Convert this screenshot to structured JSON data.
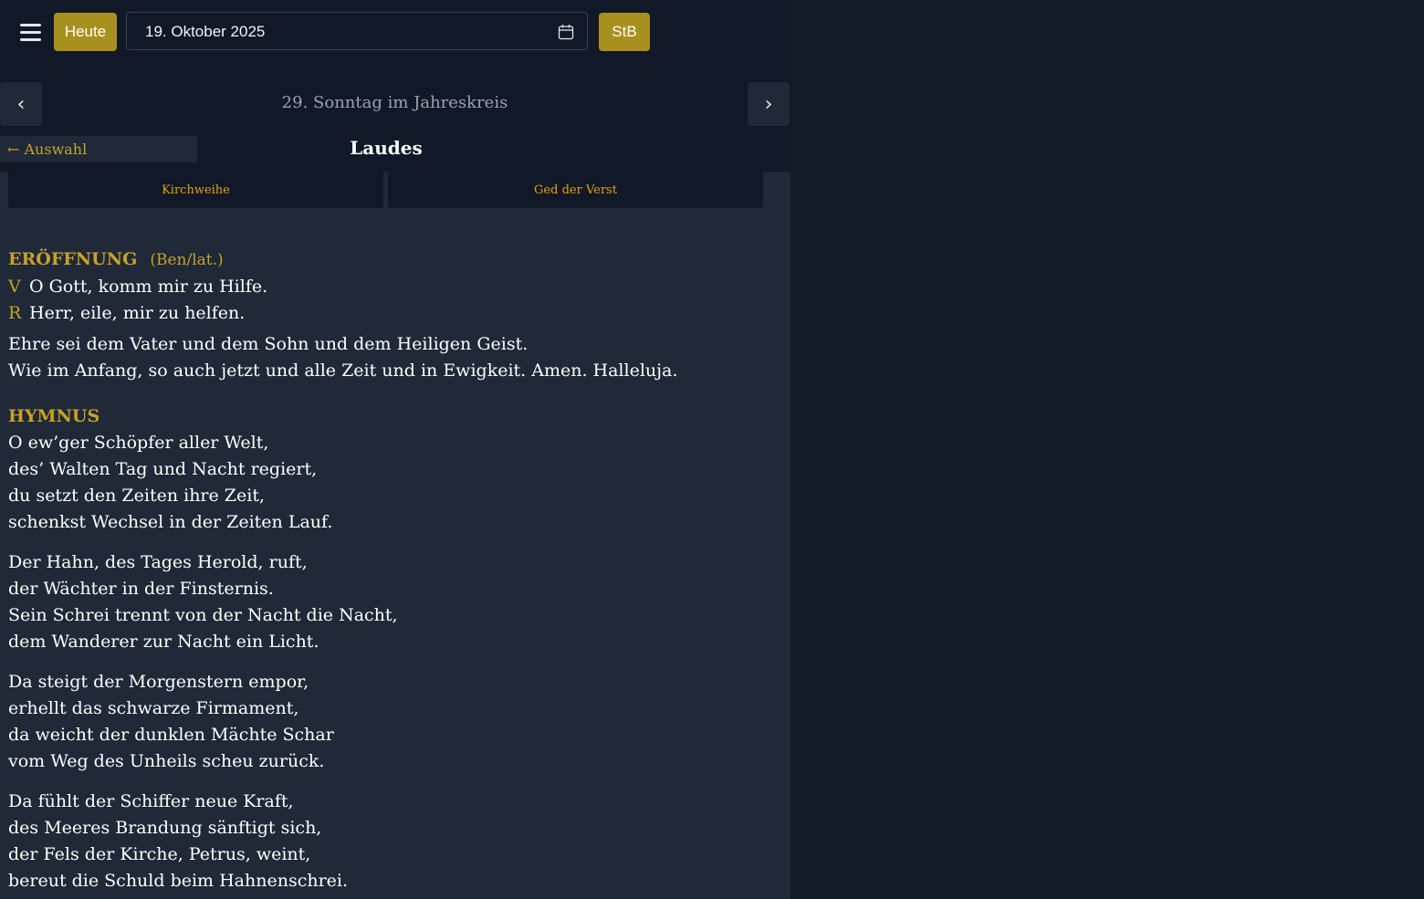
{
  "header": {
    "today_label": "Heute",
    "date_value": "19. Oktober 2025",
    "stb_label": "StB"
  },
  "nav": {
    "prev_label": "‹",
    "next_label": "›",
    "day_title": "29. Sonntag im Jahreskreis",
    "back_label": "← Auswahl",
    "hour_title": "Laudes"
  },
  "tabs": [
    "Kirchweihe",
    "Ged der Verst"
  ],
  "opening": {
    "heading": "ERÖFFNUNG",
    "heading_sub": "(Ben/lat.)",
    "v_mark": "V",
    "v_text": "O Gott, komm mir zu Hilfe.",
    "r_mark": "R",
    "r_text": "Herr, eile, mir zu helfen.",
    "doxology": [
      "Ehre sei dem Vater und dem Sohn und dem Heiligen Geist.",
      "Wie im Anfang, so auch jetzt und alle Zeit und in Ewigkeit. Amen. Halleluja."
    ]
  },
  "hymn": {
    "heading": "HYMNUS",
    "stanzas": [
      [
        "O ew’ger Schöpfer aller Welt,",
        "des’ Walten Tag und Nacht regiert,",
        "du setzt den Zeiten ihre Zeit,",
        "schenkst Wechsel in der Zeiten Lauf."
      ],
      [
        "Der Hahn, des Tages Herold, ruft,",
        "der Wächter in der Finsternis.",
        "Sein Schrei trennt von der Nacht die Nacht,",
        "dem Wanderer zur Nacht ein Licht."
      ],
      [
        "Da steigt der Morgenstern empor,",
        "erhellt das schwarze Firmament,",
        "da weicht der dunklen Mächte Schar",
        "vom Weg des Unheils scheu zurück."
      ],
      [
        "Da fühlt der Schiffer neue Kraft,",
        "des Meeres Brandung sänftigt sich,",
        "der Fels der Kirche, Petrus, weint,",
        "bereut die Schuld beim Hahnenschrei."
      ]
    ]
  }
}
